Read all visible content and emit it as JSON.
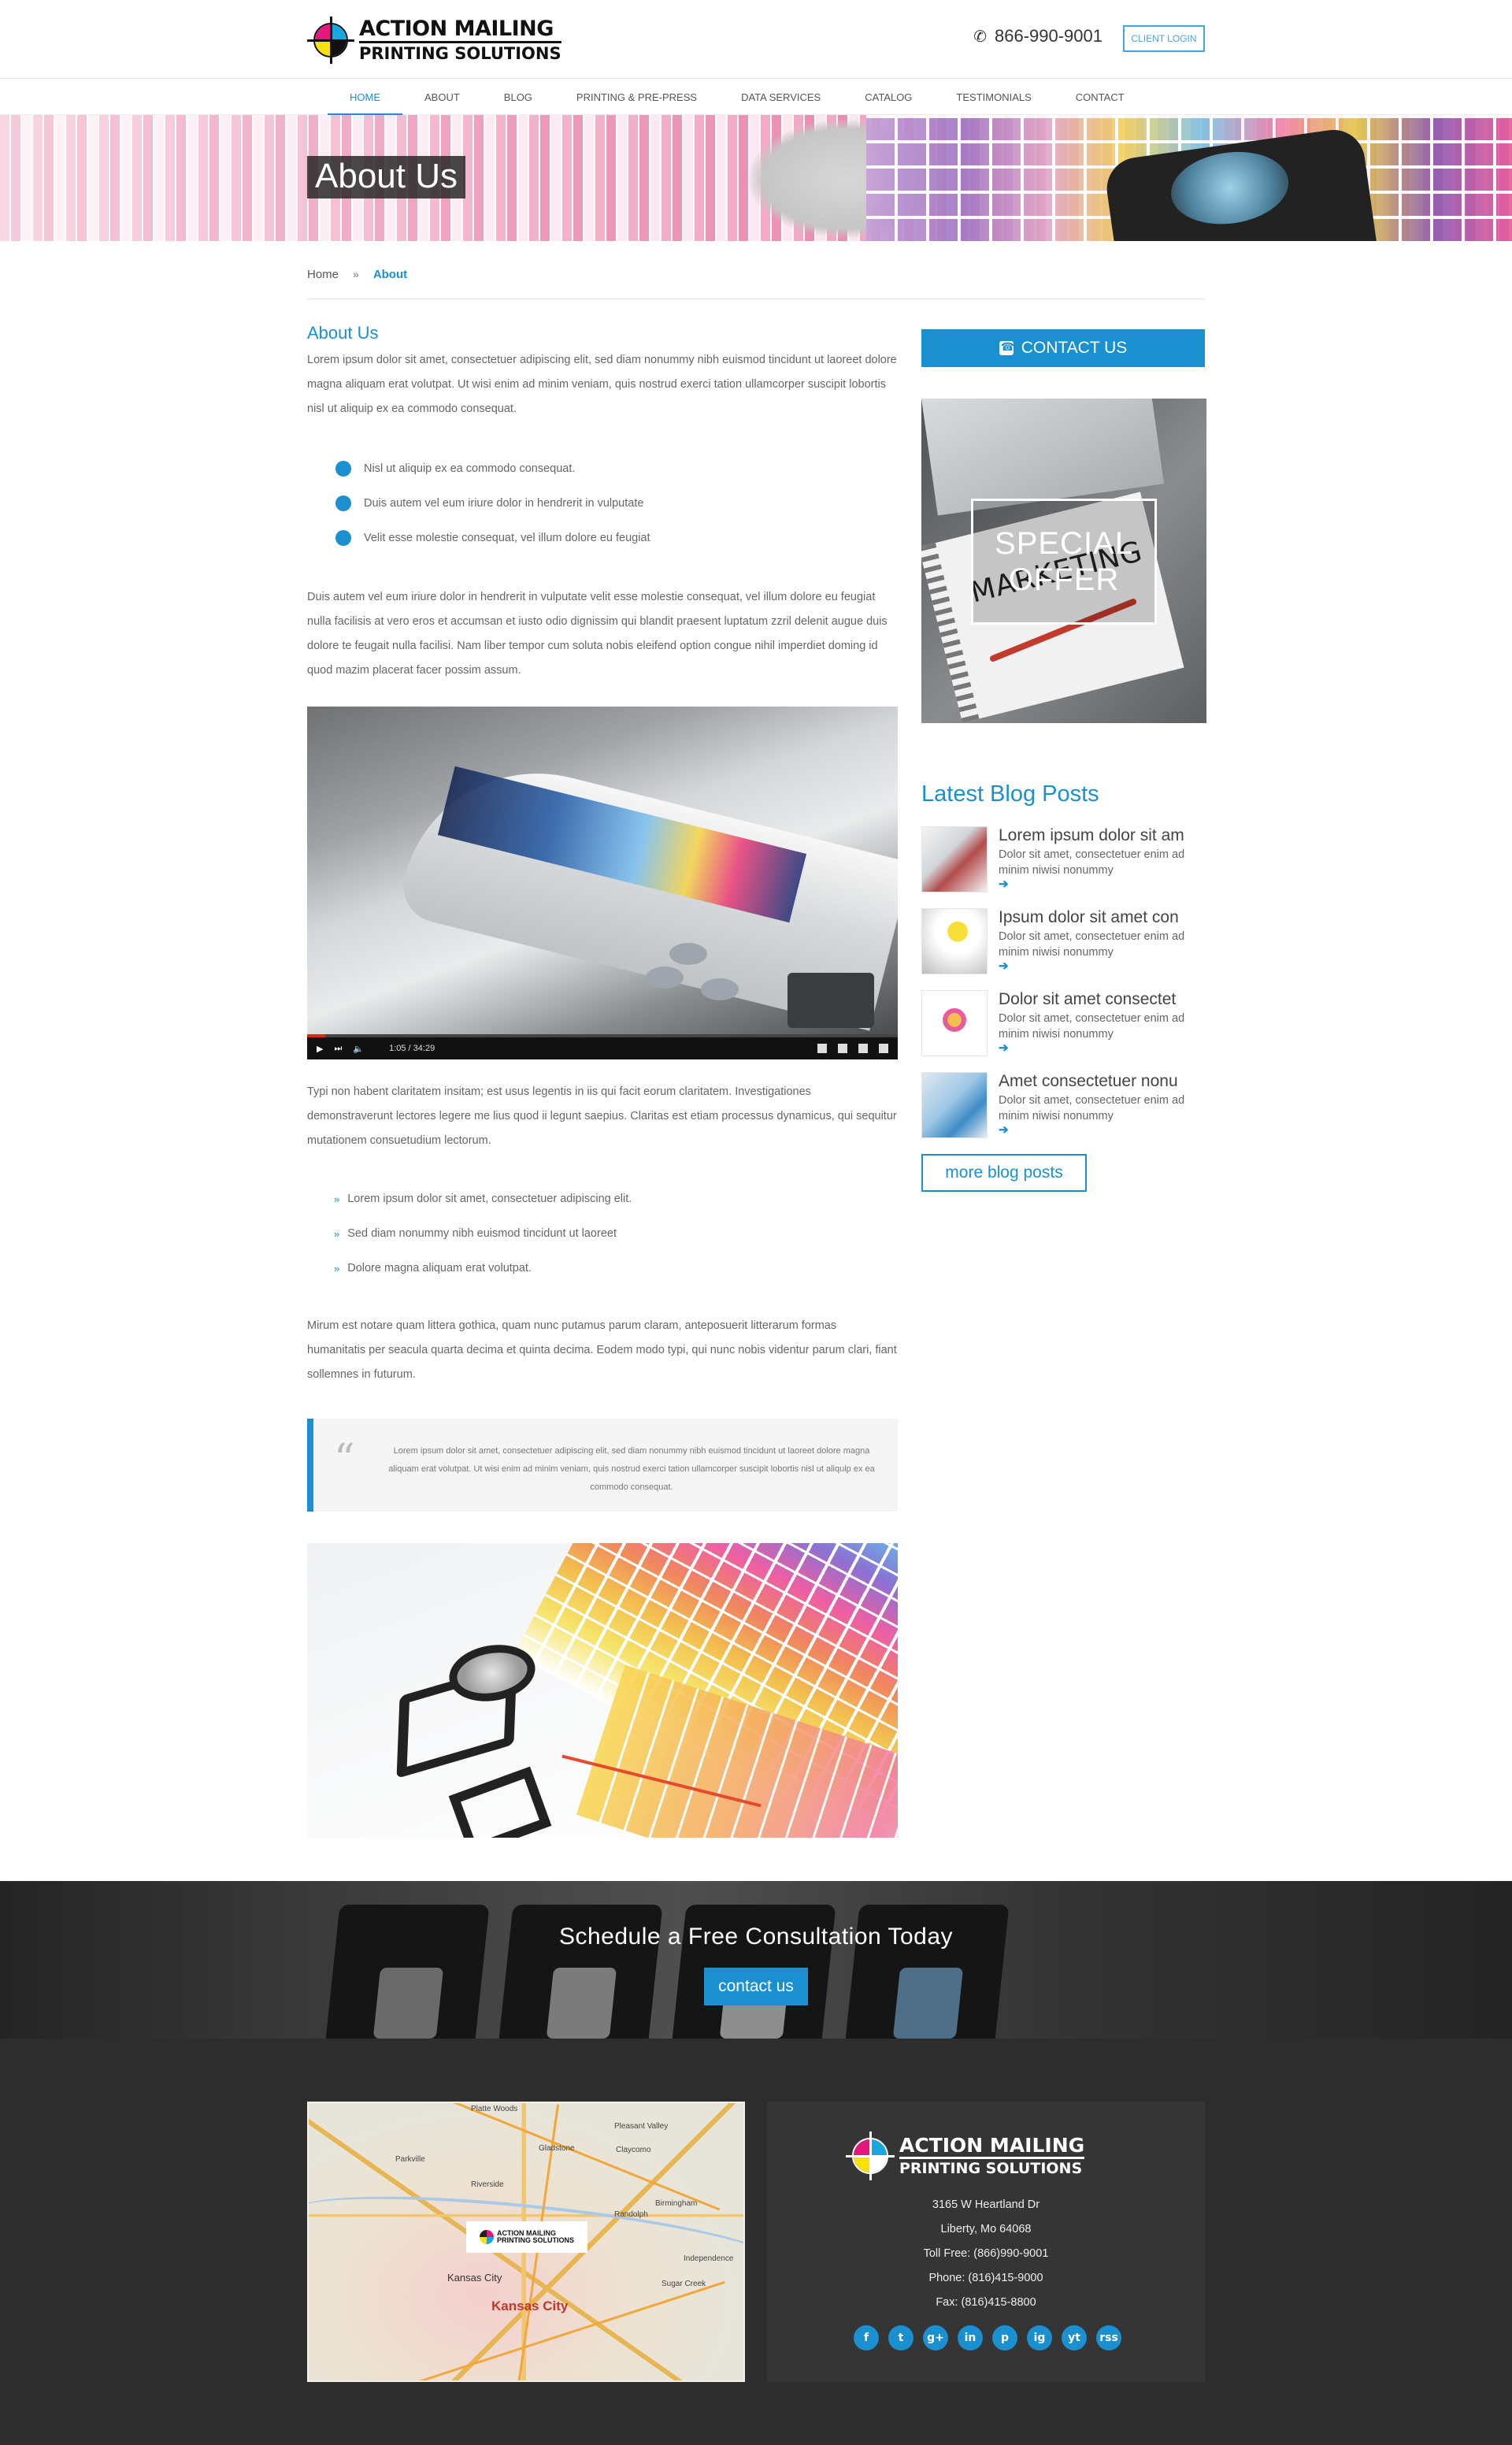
{
  "header": {
    "brand_line1": "ACTION MAILING",
    "brand_line2": "PRINTING SOLUTIONS",
    "phone": "866-990-9001",
    "login_label": "CLIENT LOGIN"
  },
  "nav": {
    "items": [
      {
        "label": "HOME",
        "active": true
      },
      {
        "label": "ABOUT"
      },
      {
        "label": "BLOG"
      },
      {
        "label": "PRINTING & PRE-PRESS"
      },
      {
        "label": "DATA SERVICES"
      },
      {
        "label": "CATALOG"
      },
      {
        "label": "TESTIMONIALS"
      },
      {
        "label": "CONTACT"
      }
    ]
  },
  "banner": {
    "title": "About Us"
  },
  "breadcrumb": {
    "home": "Home",
    "separator": "»",
    "current": "About"
  },
  "main": {
    "heading": "About Us",
    "intro": "Lorem ipsum dolor sit amet, consectetuer adipiscing elit, sed diam nonummy nibh euismod tincidunt ut laoreet dolore magna aliquam erat volutpat. Ut wisi enim ad minim veniam, quis nostrud exerci tation ullamcorper suscipit lobortis nisl ut aliquip ex ea commodo consequat.",
    "dot_list": [
      "Nisl ut aliquip ex ea commodo consequat.",
      "Duis autem vel eum iriure dolor in hendrerit in vulputate",
      "Velit esse molestie consequat, vel illum dolore eu feugiat"
    ],
    "para2": "Duis autem vel eum iriure dolor in hendrerit in vulputate velit esse molestie consequat, vel illum dolore eu feugiat nulla facilisis at vero eros et accumsan et iusto odio dignissim qui blandit praesent luptatum zzril delenit augue duis dolore te feugait nulla facilisi. Nam liber tempor cum soluta nobis eleifend option congue nihil imperdiet doming id quod mazim placerat facer possim assum.",
    "video": {
      "time": "1:05 / 34:29",
      "progress": 0.03
    },
    "para3": "Typi non habent claritatem insitam; est usus legentis in iis qui facit eorum claritatem. Investigationes demonstraverunt lectores legere me lius quod ii legunt saepius. Claritas est etiam processus dynamicus, qui sequitur mutationem consuetudium lectorum.",
    "chevron_list": [
      "Lorem ipsum dolor sit amet, consectetuer adipiscing elit.",
      "Sed diam nonummy nibh euismod tincidunt ut laoreet",
      "Dolore magna aliquam erat volutpat."
    ],
    "para4": "Mirum est notare quam littera gothica, quam nunc putamus parum claram, anteposuerit litterarum formas humanitatis per seacula quarta decima et quinta decima. Eodem modo typi, qui nunc nobis videntur parum clari, fiant sollemnes in futurum.",
    "quote": "Lorem ipsum dolor sit amet, consectetuer adipiscing elit, sed diam nonummy nibh euismod tincidunt ut laoreet dolore magna aliquam erat volutpat. Ut wisi enim ad minim veniam, quis nostrud exerci tation ullamcorper suscipit lobortis nisl ut aliquip ex ea commodo consequat."
  },
  "sidebar": {
    "contact_label": "CONTACT US",
    "offer_line1": "SPECIAL",
    "offer_line2": "OFFER",
    "offer_image_text": "MARKETING",
    "blog_heading": "Latest Blog Posts",
    "posts": [
      {
        "title": "Lorem ipsum dolor sit am",
        "excerpt": "Dolor sit amet, consectetuer enim ad minim niwisi nonummy"
      },
      {
        "title": "Ipsum dolor sit amet con",
        "excerpt": "Dolor sit amet, consectetuer enim ad minim niwisi nonummy"
      },
      {
        "title": "Dolor sit amet consectet",
        "excerpt": "Dolor sit amet, consectetuer enim ad minim niwisi nonummy"
      },
      {
        "title": "Amet consectetuer nonu",
        "excerpt": "Dolor sit amet, consectetuer enim ad minim niwisi nonummy"
      }
    ],
    "arrow": "➔",
    "more_label": "more blog posts"
  },
  "cta": {
    "title": "Schedule a Free Consultation Today",
    "button": "contact us"
  },
  "footer": {
    "map_labels": [
      "Platte Woods",
      "Gladstone",
      "Claycomo",
      "Parkville",
      "Pleasant Valley",
      "Riverside",
      "Birmingham",
      "Randolph",
      "Kansas City",
      "Sugar Creek",
      "Independence"
    ],
    "map_big_label": "Kansas City",
    "address1": "3165 W Heartland Dr",
    "address2": "Liberty, Mo 64068",
    "tollfree": "Toll Free: (866)990-9001",
    "phone": "Phone: (816)415-9000",
    "fax": "Fax: (816)415-8800",
    "socials": [
      "f",
      "t",
      "g+",
      "in",
      "p",
      "ig",
      "yt",
      "rss"
    ]
  },
  "colors": {
    "accent": "#1a90d0",
    "footer_bg": "#2d2d2d"
  }
}
